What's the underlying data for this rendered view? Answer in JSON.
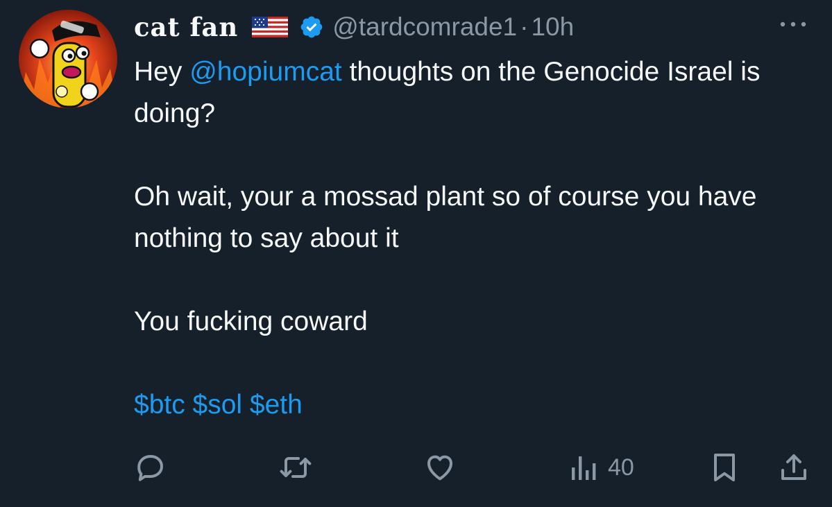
{
  "tweet": {
    "display_name": "cat fan",
    "flag": "us-flag",
    "verified": true,
    "handle": "@tardcomrade1",
    "separator": "·",
    "time": "10h",
    "body": {
      "line1_prefix": "Hey ",
      "mention": "@hopiumcat",
      "line1_suffix": " thoughts on the Genocide Israel is doing?",
      "para2": "Oh wait, your a mossad plant so of course you have nothing to say about it",
      "para3": "You fucking coward",
      "cashtags": "$btc $sol $eth"
    },
    "actions": {
      "reply_icon": "reply-icon",
      "retweet_icon": "retweet-icon",
      "like_icon": "heart-icon",
      "views_icon": "views-chart-icon",
      "views_count": "40",
      "bookmark_icon": "bookmark-icon",
      "share_icon": "share-icon"
    },
    "colors": {
      "background": "#15202b",
      "text": "#f7f9f9",
      "secondary": "#8b98a5",
      "accent": "#1d9bf0"
    }
  }
}
